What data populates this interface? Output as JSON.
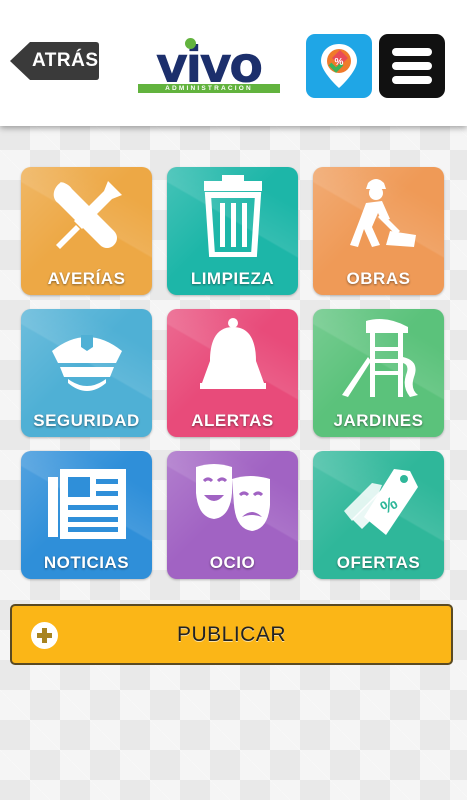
{
  "header": {
    "back_label": "ATRÁS",
    "logo": {
      "word": "vivo",
      "subtitle": "ADMINISTRACION"
    },
    "offers_app_icon": "price-tag-percent-icon",
    "menu_icon": "hamburger-menu-icon"
  },
  "tiles": [
    {
      "label": "AVERÍAS",
      "icon": "wrench-screwdriver-icon",
      "color": "#eda845"
    },
    {
      "label": "LIMPIEZA",
      "icon": "trash-bin-icon",
      "color": "#1db6a8"
    },
    {
      "label": "OBRAS",
      "icon": "construction-worker-icon",
      "color": "#ef9a57"
    },
    {
      "label": "SEGURIDAD",
      "icon": "police-cap-icon",
      "color": "#4fb0d5"
    },
    {
      "label": "ALERTAS",
      "icon": "bell-icon",
      "color": "#e84b7a"
    },
    {
      "label": "JARDINES",
      "icon": "playground-icon",
      "color": "#5bc27b"
    },
    {
      "label": "NOTICIAS",
      "icon": "newspaper-icon",
      "color": "#2f8fd9"
    },
    {
      "label": "OCIO",
      "icon": "theater-masks-icon",
      "color": "#a163c3"
    },
    {
      "label": "OFERTAS",
      "icon": "discount-tags-icon",
      "color": "#2fb79a"
    }
  ],
  "publish": {
    "label": "PUBLICAR",
    "icon": "plus-circle-icon",
    "color": "#fbb617"
  }
}
